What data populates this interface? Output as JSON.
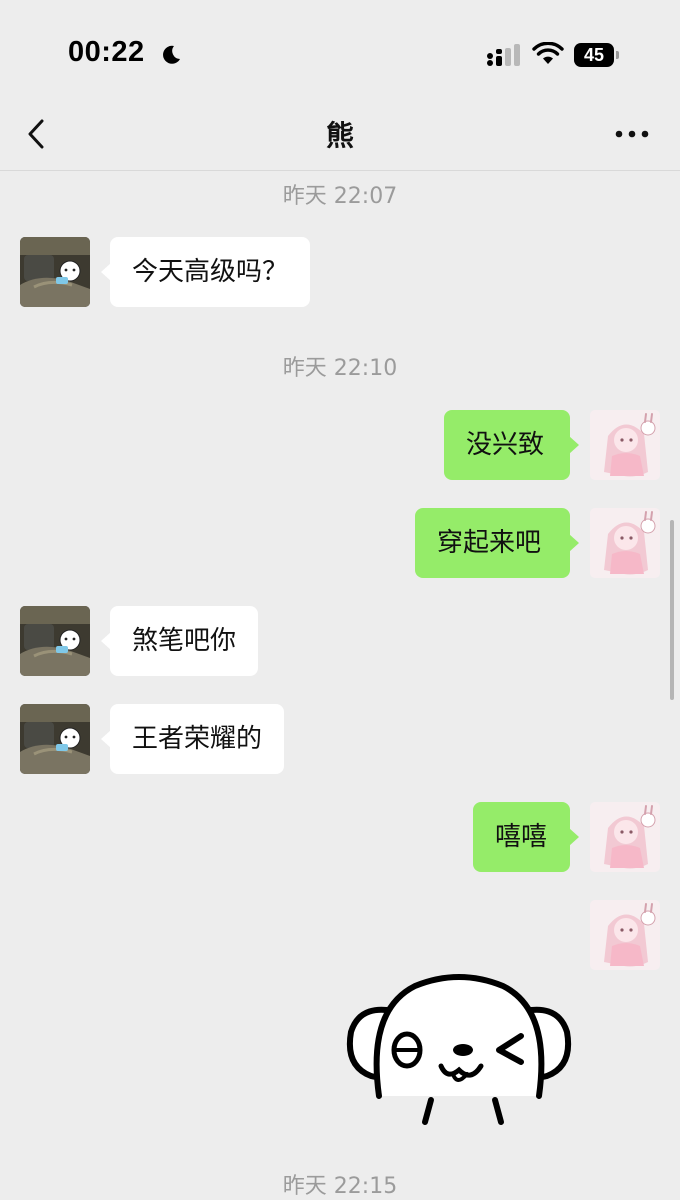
{
  "status_bar": {
    "time": "00:22",
    "battery_level": "45",
    "icons": [
      "moon-icon",
      "cellular-signal-icon",
      "wifi-icon",
      "battery-icon"
    ]
  },
  "header": {
    "title": "熊",
    "back_icon": "chevron-left-icon",
    "more_icon": "ellipsis-icon"
  },
  "timestamps": [
    "昨天 22:07",
    "昨天 22:10",
    "昨天 22:15"
  ],
  "messages": [
    {
      "sender": "other",
      "text": "今天高级吗？"
    },
    {
      "sender": "me",
      "text": "没兴致"
    },
    {
      "sender": "me",
      "text": "穿起来吧"
    },
    {
      "sender": "other",
      "text": "煞笔吧你"
    },
    {
      "sender": "other",
      "text": "王者荣耀的"
    },
    {
      "sender": "me",
      "text": "嘻嘻"
    },
    {
      "sender": "me",
      "sticker": "winking-dog-sticker"
    }
  ],
  "colors": {
    "background": "#ededed",
    "my_bubble": "#95ec69",
    "their_bubble": "#ffffff",
    "timestamp_text": "#9b9b9b"
  }
}
